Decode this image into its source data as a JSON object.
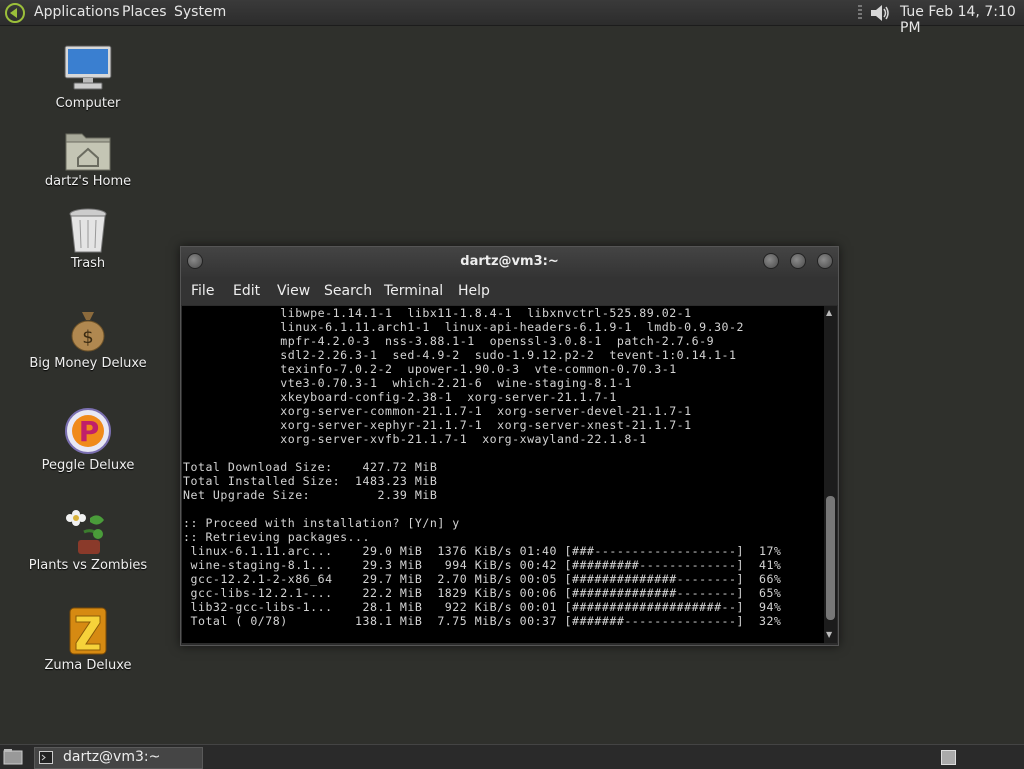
{
  "top_panel": {
    "menus": [
      "Applications",
      "Places",
      "System"
    ],
    "clock": "Tue Feb 14,  7:10 PM",
    "icons": {
      "menu": "gnome-foot-icon",
      "volume": "volume-icon"
    }
  },
  "desktop": {
    "icons": [
      {
        "label": "Computer",
        "icon": "computer-icon"
      },
      {
        "label": "dartz's Home",
        "icon": "home-folder-icon"
      },
      {
        "label": "Trash",
        "icon": "trash-icon"
      },
      {
        "label": "Big Money Deluxe",
        "icon": "money-bag-icon"
      },
      {
        "label": "Peggle Deluxe",
        "icon": "peggle-icon"
      },
      {
        "label": "Plants vs Zombies",
        "icon": "plants-icon"
      },
      {
        "label": "Zuma Deluxe",
        "icon": "zuma-icon"
      }
    ]
  },
  "terminal": {
    "title": "dartz@vm3:~",
    "menu": [
      "File",
      "Edit",
      "View",
      "Search",
      "Terminal",
      "Help"
    ],
    "lines": [
      "             libwpe-1.14.1-1  libx11-1.8.4-1  libxnvctrl-525.89.02-1",
      "             linux-6.1.11.arch1-1  linux-api-headers-6.1.9-1  lmdb-0.9.30-2",
      "             mpfr-4.2.0-3  nss-3.88.1-1  openssl-3.0.8-1  patch-2.7.6-9",
      "             sdl2-2.26.3-1  sed-4.9-2  sudo-1.9.12.p2-2  tevent-1:0.14.1-1",
      "             texinfo-7.0.2-2  upower-1.90.0-3  vte-common-0.70.3-1",
      "             vte3-0.70.3-1  which-2.21-6  wine-staging-8.1-1",
      "             xkeyboard-config-2.38-1  xorg-server-21.1.7-1",
      "             xorg-server-common-21.1.7-1  xorg-server-devel-21.1.7-1",
      "             xorg-server-xephyr-21.1.7-1  xorg-server-xnest-21.1.7-1",
      "             xorg-server-xvfb-21.1.7-1  xorg-xwayland-22.1.8-1",
      "",
      "Total Download Size:    427.72 MiB",
      "Total Installed Size:  1483.23 MiB",
      "Net Upgrade Size:         2.39 MiB",
      "",
      ":: Proceed with installation? [Y/n] y",
      ":: Retrieving packages...",
      " linux-6.1.11.arc...    29.0 MiB  1376 KiB/s 01:40 [###-------------------]  17%",
      " wine-staging-8.1...    29.3 MiB   994 KiB/s 00:42 [#########-------------]  41%",
      " gcc-12.2.1-2-x86_64    29.7 MiB  2.70 MiB/s 00:05 [##############--------]  66%",
      " gcc-libs-12.2.1-...    22.2 MiB  1829 KiB/s 00:06 [##############--------]  65%",
      " lib32-gcc-libs-1...    28.1 MiB   922 KiB/s 00:01 [####################--]  94%",
      " Total ( 0/78)         138.1 MiB  7.75 MiB/s 00:37 [#######---------------]  32%"
    ]
  },
  "taskbar": {
    "window_label": "dartz@vm3:~",
    "icons": {
      "show_desktop": "show-desktop-icon",
      "task": "terminal-icon",
      "workspace": "workspace-switcher"
    }
  }
}
